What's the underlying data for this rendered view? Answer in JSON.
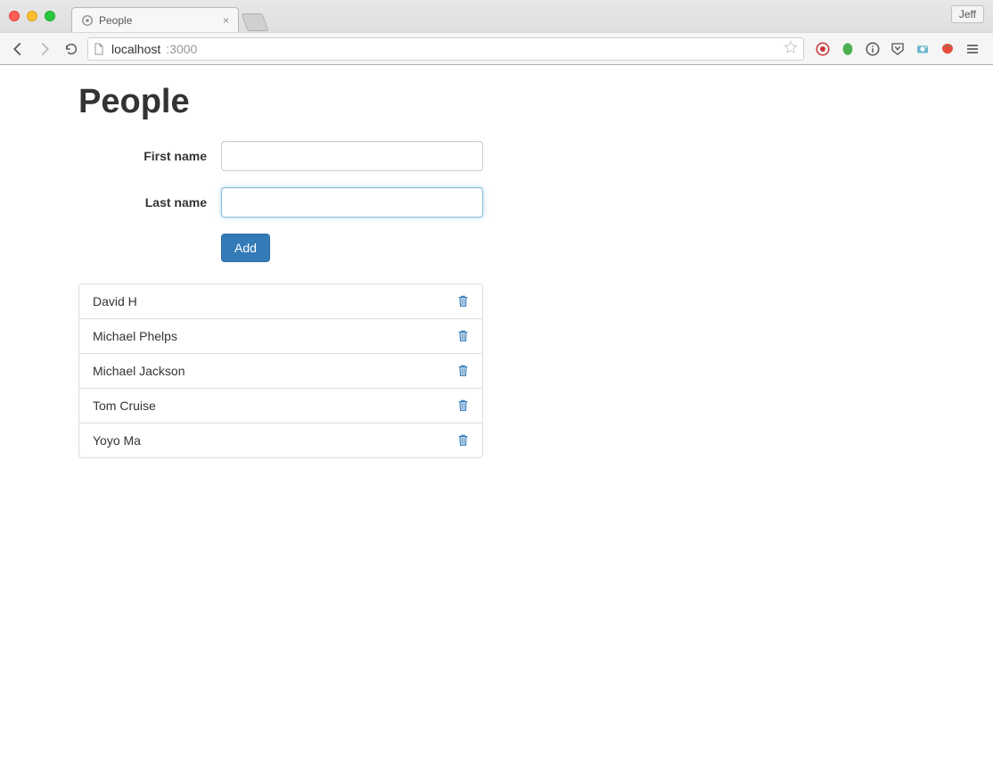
{
  "browser": {
    "tab_title": "People",
    "profile_name": "Jeff",
    "url_host": "localhost",
    "url_port": ":3000"
  },
  "page": {
    "title": "People",
    "form": {
      "first_name_label": "First name",
      "last_name_label": "Last name",
      "first_name_value": "",
      "last_name_value": "",
      "add_button": "Add"
    },
    "people": [
      {
        "name": "David H"
      },
      {
        "name": "Michael Phelps"
      },
      {
        "name": "Michael Jackson"
      },
      {
        "name": "Tom Cruise"
      },
      {
        "name": "Yoyo Ma"
      }
    ]
  },
  "colors": {
    "primary": "#337ab7",
    "border": "#ddd"
  }
}
